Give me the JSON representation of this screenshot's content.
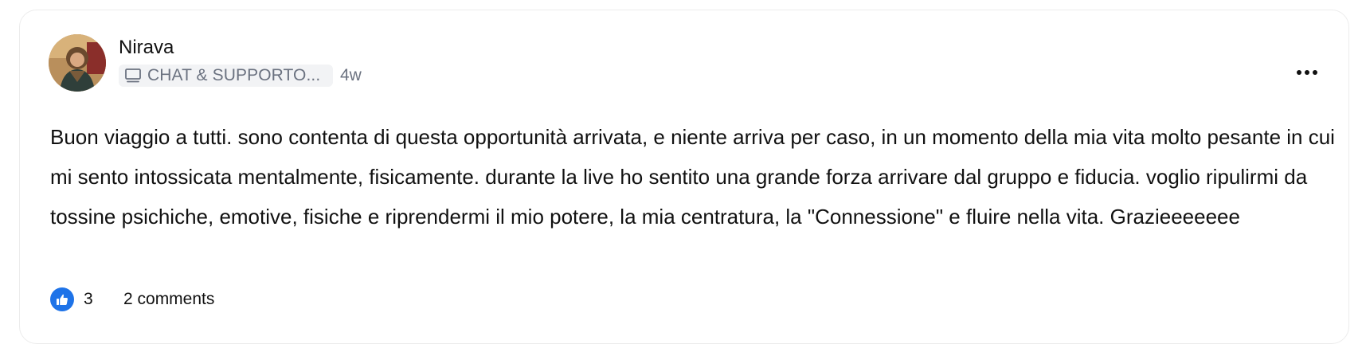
{
  "post": {
    "author": {
      "name": "Nirava",
      "avatar_icon": "avatar-photo"
    },
    "space": {
      "icon": "monitor-icon",
      "name": "CHAT & SUPPORTO..."
    },
    "time_ago": "4w",
    "more_icon": "more-horizontal-icon",
    "body": "Buon viaggio a tutti. sono contenta di questa opportunità arrivata, e niente arriva per caso, in un momento della mia vita molto pesante in cui mi sento intossicata mentalmente, fisicamente. durante la live ho sentito una grande forza arrivare dal gruppo e fiducia. voglio ripulirmi da tossine psichiche, emotive, fisiche e riprendermi il mio potere, la mia centratura, la \"Connessione\" e fluire nella vita. Grazieeeeeee",
    "reactions": {
      "like_icon": "thumbs-up-icon",
      "like_count": "3",
      "comments_label": "2 comments"
    }
  },
  "colors": {
    "like_accent": "#1e73e8",
    "muted_text": "#6b7280",
    "badge_bg": "#f2f3f5"
  }
}
